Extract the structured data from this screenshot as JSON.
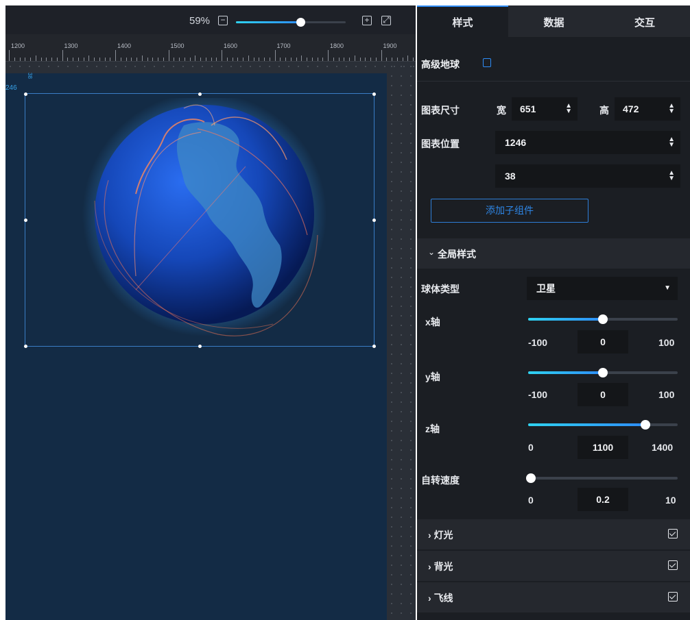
{
  "zoom": {
    "percent_label": "59%",
    "level": 0.59,
    "minus": "−",
    "plus": "+"
  },
  "ruler": {
    "ticks": [
      "1200",
      "1300",
      "1400",
      "1500",
      "1600",
      "1700",
      "1800",
      "1900"
    ]
  },
  "canvas": {
    "origin_x": "246",
    "origin_y": "38"
  },
  "tabs": [
    "样式",
    "数据",
    "交互"
  ],
  "component": {
    "title": "高级地球"
  },
  "size": {
    "label": "图表尺寸",
    "w_label": "宽",
    "w": "651",
    "h_label": "高",
    "h": "472"
  },
  "position": {
    "label": "图表位置",
    "x": "1246",
    "y": "38"
  },
  "add_child": "添加子组件",
  "global_style": {
    "header": "全局样式",
    "sphere_label": "球体类型",
    "sphere_value": "卫星",
    "x_axis": {
      "label": "x轴",
      "min": "-100",
      "max": "100",
      "value": "0",
      "fraction": 0.5
    },
    "y_axis": {
      "label": "y轴",
      "min": "-100",
      "max": "100",
      "value": "0",
      "fraction": 0.5
    },
    "z_axis": {
      "label": "z轴",
      "min": "0",
      "max": "1400",
      "value": "1100",
      "fraction": 0.7857
    },
    "spin": {
      "label": "自转速度",
      "min": "0",
      "max": "10",
      "value": "0.2",
      "fraction": 0.02
    }
  },
  "sections": [
    "灯光",
    "背光",
    "飞线"
  ],
  "colors": {
    "accent": "#2e8df7",
    "stage": "#132b45",
    "panel": "#1b1e23"
  }
}
